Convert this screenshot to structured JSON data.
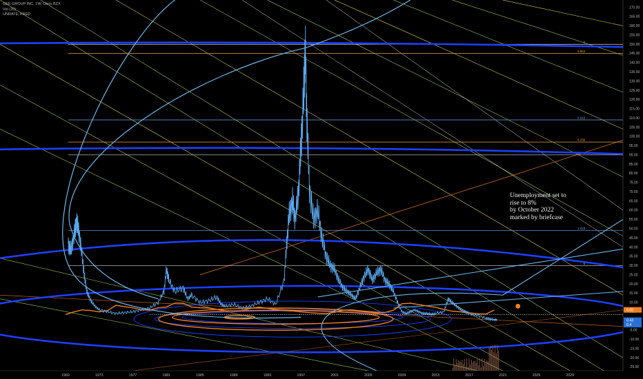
{
  "legend": {
    "symbol_line": "GEE GROUP INC, 1W, Cboe BZX",
    "volume_line": "Vol (20)",
    "series_line": "UNRATE, FRED"
  },
  "annotation": {
    "lines": [
      "Unemployment set to",
      "rise to 8%",
      "by October 2022",
      "marked by briefcase"
    ]
  },
  "colors": {
    "background": "#000000",
    "price": "#5aa9ef",
    "unrate": "#f07f1f",
    "ellipse": "#1f3fff",
    "arc": "#6fb8ee",
    "fan_green": "#a5c95a",
    "fan_yellow": "#d9cf5a",
    "fib": "#e8a24a"
  },
  "chart_data": {
    "type": "line",
    "series": [
      {
        "values": [
          [
            1969.3,
            42
          ],
          [
            1969.6,
            38
          ],
          [
            1970.0,
            46
          ],
          [
            1970.3,
            54
          ],
          [
            1970.6,
            48
          ],
          [
            1971.0,
            34
          ],
          [
            1971.3,
            22
          ],
          [
            1971.6,
            15
          ],
          [
            1972.0,
            11
          ],
          [
            1972.5,
            8
          ],
          [
            1973.0,
            6
          ],
          [
            1974.0,
            5
          ],
          [
            1975.0,
            4
          ],
          [
            1976.0,
            4.5
          ],
          [
            1977.0,
            5
          ],
          [
            1978.0,
            6
          ],
          [
            1979.0,
            7
          ],
          [
            1980.0,
            10
          ],
          [
            1980.7,
            16
          ],
          [
            1981.0,
            28
          ],
          [
            1981.3,
            22
          ],
          [
            1982.0,
            16
          ],
          [
            1983.0,
            18
          ],
          [
            1983.5,
            12
          ],
          [
            1984.0,
            14
          ],
          [
            1985.0,
            10
          ],
          [
            1986.0,
            11
          ],
          [
            1987.0,
            13
          ],
          [
            1987.5,
            9
          ],
          [
            1988.0,
            8
          ],
          [
            1989.0,
            9
          ],
          [
            1990.0,
            7
          ],
          [
            1991.0,
            8
          ],
          [
            1992.0,
            10
          ],
          [
            1993.0,
            12
          ],
          [
            1994.0,
            9
          ],
          [
            1995.0,
            22
          ],
          [
            1995.3,
            42
          ],
          [
            1995.6,
            58
          ],
          [
            1996.0,
            65
          ],
          [
            1996.3,
            55
          ],
          [
            1996.7,
            70
          ],
          [
            1997.0,
            95
          ],
          [
            1997.3,
            120
          ],
          [
            1997.5,
            148
          ],
          [
            1997.7,
            110
          ],
          [
            1998.0,
            72
          ],
          [
            1998.5,
            55
          ],
          [
            1999.0,
            60
          ],
          [
            1999.5,
            45
          ],
          [
            2000.0,
            35
          ],
          [
            2000.5,
            30
          ],
          [
            2001.0,
            28
          ],
          [
            2001.5,
            22
          ],
          [
            2002.0,
            18
          ],
          [
            2002.5,
            16
          ],
          [
            2003.0,
            14
          ],
          [
            2003.5,
            12
          ],
          [
            2004.0,
            18
          ],
          [
            2004.5,
            24
          ],
          [
            2005.0,
            28
          ],
          [
            2005.5,
            22
          ],
          [
            2006.0,
            26
          ],
          [
            2006.5,
            28
          ],
          [
            2007.0,
            22
          ],
          [
            2007.5,
            20
          ],
          [
            2008.0,
            16
          ],
          [
            2008.5,
            10
          ],
          [
            2009.0,
            5
          ],
          [
            2009.5,
            4
          ],
          [
            2010.0,
            5
          ],
          [
            2010.5,
            6
          ],
          [
            2011.0,
            5
          ],
          [
            2011.5,
            4
          ],
          [
            2012.0,
            4
          ],
          [
            2012.5,
            3.5
          ],
          [
            2013.0,
            4
          ],
          [
            2014.0,
            5
          ],
          [
            2014.5,
            12
          ],
          [
            2015.0,
            10
          ],
          [
            2015.5,
            8
          ],
          [
            2016.0,
            6
          ],
          [
            2016.5,
            5
          ],
          [
            2017.0,
            4
          ],
          [
            2018.0,
            3
          ],
          [
            2019.0,
            1.5
          ],
          [
            2019.5,
            1
          ],
          [
            2020.0,
            0.5
          ],
          [
            2020.3,
            0.43
          ]
        ]
      },
      {
        "values": [
          [
            1969,
            3.5
          ],
          [
            1970,
            4.9
          ],
          [
            1971,
            6.0
          ],
          [
            1972,
            5.6
          ],
          [
            1973,
            4.9
          ],
          [
            1974,
            5.6
          ],
          [
            1975,
            8.5
          ],
          [
            1976,
            7.7
          ],
          [
            1977,
            7.1
          ],
          [
            1978,
            6.1
          ],
          [
            1979,
            5.8
          ],
          [
            1980,
            7.1
          ],
          [
            1981,
            7.6
          ],
          [
            1982,
            9.7
          ],
          [
            1983,
            9.6
          ],
          [
            1984,
            7.5
          ],
          [
            1985,
            7.2
          ],
          [
            1986,
            7.0
          ],
          [
            1987,
            6.2
          ],
          [
            1988,
            5.5
          ],
          [
            1989,
            5.3
          ],
          [
            1990,
            5.6
          ],
          [
            1991,
            6.8
          ],
          [
            1992,
            7.5
          ],
          [
            1993,
            6.9
          ],
          [
            1994,
            6.1
          ],
          [
            1995,
            5.6
          ],
          [
            1996,
            5.4
          ],
          [
            1997,
            4.9
          ],
          [
            1998,
            4.5
          ],
          [
            1999,
            4.2
          ],
          [
            2000,
            4.0
          ],
          [
            2001,
            4.7
          ],
          [
            2002,
            5.8
          ],
          [
            2003,
            6.0
          ],
          [
            2004,
            5.5
          ],
          [
            2005,
            5.1
          ],
          [
            2006,
            4.6
          ],
          [
            2007,
            4.6
          ],
          [
            2008,
            5.8
          ],
          [
            2009,
            9.3
          ],
          [
            2010,
            9.6
          ],
          [
            2011,
            8.9
          ],
          [
            2012,
            8.1
          ],
          [
            2013,
            7.4
          ],
          [
            2014,
            6.2
          ],
          [
            2015,
            5.3
          ],
          [
            2016,
            4.9
          ],
          [
            2017,
            4.4
          ],
          [
            2018,
            3.9
          ],
          [
            2019,
            3.7
          ],
          [
            2020,
            6.0
          ]
        ]
      }
    ],
    "x_ticks": [
      "1969",
      "1973",
      "1977",
      "1981",
      "1985",
      "1989",
      "1993",
      "1997",
      "2001",
      "2005",
      "2009",
      "2013",
      "2017",
      "2021",
      "2025",
      "2029"
    ],
    "x_tick_values": [
      1969,
      1973,
      1977,
      1981,
      1985,
      1989,
      1993,
      1997,
      2001,
      2005,
      2009,
      2013,
      2017,
      2021,
      2025,
      2029
    ],
    "y_ticks": [
      "170.00",
      "165.00",
      "160.00",
      "155.00",
      "150.00",
      "145.00",
      "140.00",
      "135.00",
      "130.00",
      "125.00",
      "120.00",
      "115.00",
      "110.00",
      "105.00",
      "100.00",
      "95.00",
      "90.00",
      "85.00",
      "80.00",
      "75.00",
      "70.00",
      "65.00",
      "60.00",
      "55.00",
      "50.00",
      "45.00",
      "40.00",
      "35.00",
      "30.00",
      "25.00",
      "20.00",
      "15.00",
      "10.00",
      "5.00",
      "0",
      "-5.00",
      "-10.00",
      "-15.00",
      "-20.00",
      "-25.00"
    ],
    "y_tick_values": [
      170,
      165,
      160,
      155,
      150,
      145,
      140,
      135,
      130,
      125,
      120,
      115,
      110,
      105,
      100,
      95,
      90,
      85,
      80,
      75,
      70,
      65,
      60,
      55,
      50,
      45,
      40,
      35,
      30,
      25,
      20,
      15,
      10,
      5,
      0,
      -5,
      -10,
      -15,
      -20,
      -25
    ],
    "xlim": [
      1961.2,
      2035.3
    ],
    "ylim": [
      -27,
      174
    ],
    "fib_levels": [
      {
        "value": 150,
        "label": "1"
      },
      {
        "value": 145,
        "label": "0.854"
      },
      {
        "value": 109,
        "label": "0.618"
      },
      {
        "value": 97,
        "label": "0.236"
      },
      {
        "value": 90,
        "label": "0"
      },
      {
        "value": 49,
        "label": "1.618"
      },
      {
        "value": 30,
        "label": "0"
      }
    ],
    "price_badges": [
      {
        "value": 6.0,
        "label": "6.00",
        "color": "#f07f1f"
      },
      {
        "value": 0.43,
        "label": "0.43",
        "color": "#2a6fd6"
      },
      {
        "value": -2,
        "label": "0.4",
        "color": "#2a6fd6"
      }
    ],
    "grid": false,
    "legend_position": "top-left"
  }
}
